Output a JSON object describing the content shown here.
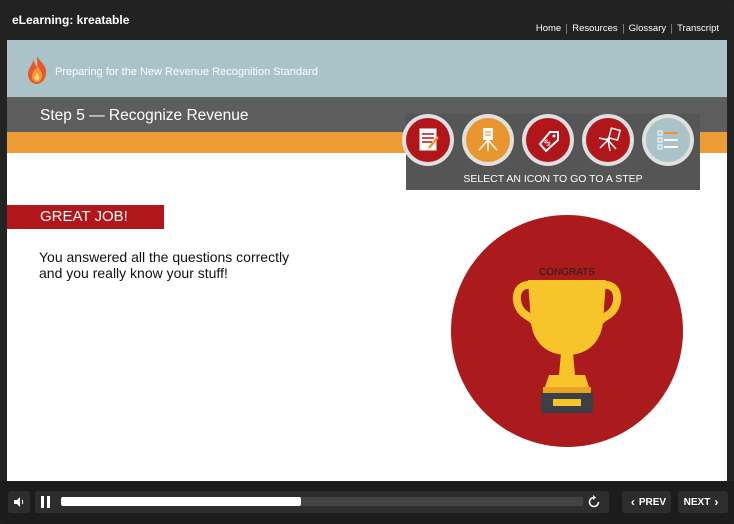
{
  "app": {
    "title": "eLearning: kreatable"
  },
  "nav_links": [
    {
      "label": "Home"
    },
    {
      "label": "Resources"
    },
    {
      "label": "Glossary"
    },
    {
      "label": "Transcript"
    }
  ],
  "course": {
    "title": "Preparing for the New Revenue Recognition Standard"
  },
  "step": {
    "title": "Step 5 — Recognize Revenue"
  },
  "step_selector": {
    "caption": "SELECT AN ICON TO GO TO A STEP",
    "icons": [
      {
        "name": "contract-icon",
        "color": "#b0161a"
      },
      {
        "name": "obligations-icon",
        "color": "#e9962f"
      },
      {
        "name": "price-tag-icon",
        "color": "#b0161a"
      },
      {
        "name": "allocate-icon",
        "color": "#b0161a"
      },
      {
        "name": "checklist-icon",
        "color": "#a9c3c9"
      }
    ]
  },
  "feedback": {
    "banner": "GREAT JOB!",
    "line1": "You answered all the questions correctly",
    "line2": "and you really know your stuff!",
    "trophy_label": "CONGRATS"
  },
  "player": {
    "progress": 0.46,
    "prev_label": "PREV",
    "next_label": "NEXT"
  },
  "colors": {
    "accent_red": "#b0161a",
    "accent_orange": "#ec9c35",
    "header_teal": "#a9c3c9",
    "step_gray": "#5d5d5d"
  }
}
